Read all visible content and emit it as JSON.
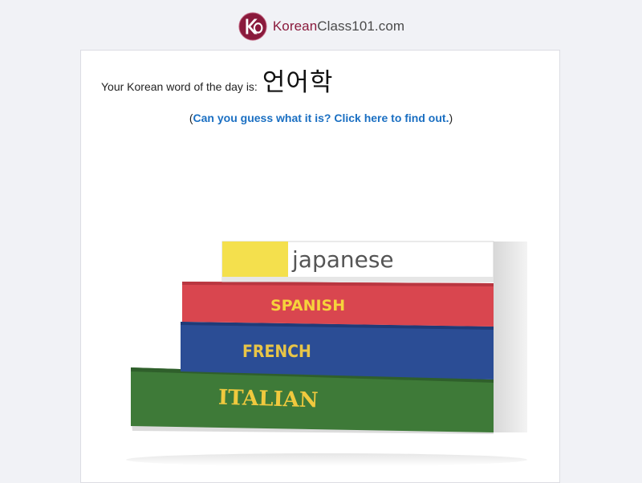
{
  "header": {
    "logo_brand": "Korean",
    "logo_rest": "Class101.com"
  },
  "word_of_day": {
    "label": "Your Korean word of the day is:",
    "word": "언어학"
  },
  "guess": {
    "open_paren": "(",
    "link_text": "Can you guess what it is? Click here to find out.",
    "close_paren": ")"
  },
  "image": {
    "books": [
      {
        "label": "japanese",
        "cover_color": "#ffffff",
        "accent_color": "#f4e04d",
        "text_color": "#555555"
      },
      {
        "label": "SPANISH",
        "cover_color": "#d9464f",
        "text_color": "#f6d33c"
      },
      {
        "label": "FRENCH",
        "cover_color": "#2b4d95",
        "text_color": "#e8c547"
      },
      {
        "label": "ITALIAN",
        "cover_color": "#3e7a38",
        "text_color": "#f0c93e"
      }
    ]
  },
  "colors": {
    "brand": "#8a1a3c",
    "link": "#1a6fc2",
    "background": "#f1f2f6"
  }
}
